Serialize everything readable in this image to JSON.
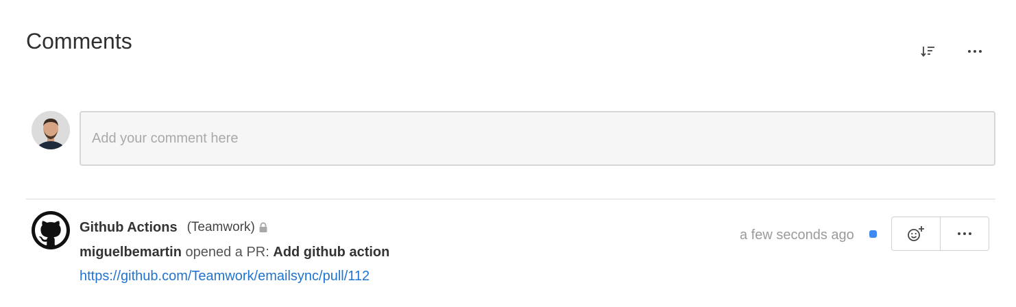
{
  "header": {
    "title": "Comments",
    "sort_icon": "sort-descending-icon",
    "more_icon": "ellipsis-icon"
  },
  "composer": {
    "placeholder": "Add your comment here",
    "avatar_icon": "user-avatar"
  },
  "comments": [
    {
      "author": "Github Actions",
      "company": "(Teamwork)",
      "privacy_icon": "lock-icon",
      "actor": "miguelbemartin",
      "action_text": "opened a PR:",
      "pr_title": "Add github action",
      "link": "https://github.com/Teamwork/emailsync/pull/112",
      "timestamp": "a few seconds ago",
      "unread_color": "#3d8bf0",
      "reaction_icon": "add-reaction-icon",
      "more_icon": "ellipsis-icon"
    }
  ],
  "colors": {
    "link": "#1f73d1",
    "muted": "#9a9a9a",
    "accent": "#3d8bf0"
  }
}
